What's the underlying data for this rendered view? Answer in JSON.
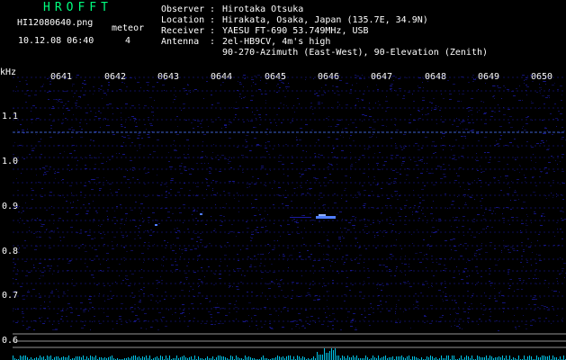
{
  "app": {
    "title": "HROFFT",
    "filename": "HI12080640.png",
    "datetime": "10.12.08 06:40",
    "meteor_label": "meteor",
    "meteor_count": "4"
  },
  "meta": {
    "observer_label": "Observer",
    "observer_value": "Hirotaka Otsuka",
    "location_label": "Location",
    "location_value": "Hirakata, Osaka, Japan (135.7E, 34.9N)",
    "receiver_label": "Receiver",
    "receiver_value": "YAESU FT-690 53.749MHz, USB",
    "antenna_label": "Antenna",
    "antenna_value": "2el-HB9CV, 4m's high",
    "antenna_value2": "90-270-Azimuth (East-West), 90-Elevation (Zenith)",
    "separator": ":"
  },
  "axis": {
    "unit": "kHz",
    "time_ticks": [
      "0641",
      "0642",
      "0643",
      "0644",
      "0645",
      "0646",
      "0647",
      "0648",
      "0649",
      "0650"
    ],
    "freq_ticks": [
      "1.1",
      "1.0",
      "0.9",
      "0.8",
      "0.7",
      "0.6"
    ]
  },
  "colors": {
    "background": "#000000",
    "title": "#00ff7f",
    "text": "#ffffff",
    "noise": "#1a1aa0",
    "signal": "#4f7dff",
    "histogram": "#00d8ff",
    "guide_lines": "#b0b0b0"
  }
}
